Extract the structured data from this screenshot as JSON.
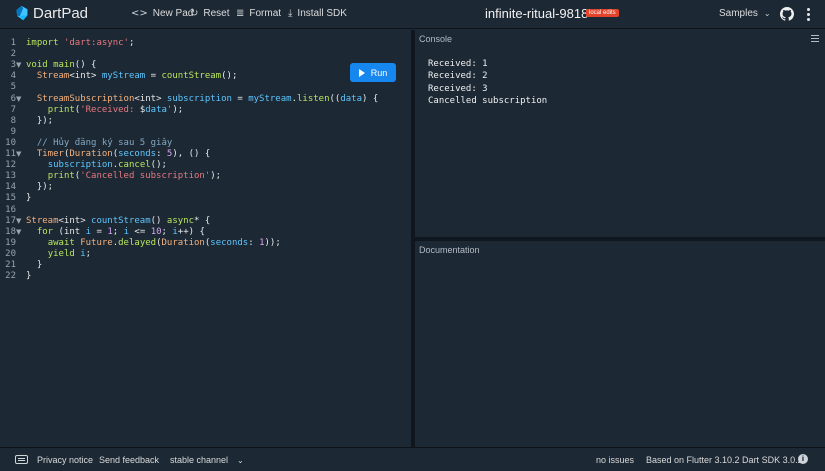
{
  "header": {
    "brand": "DartPad",
    "new_pad": "New Pad",
    "reset": "Reset",
    "format": "Format",
    "install_sdk": "Install SDK",
    "title": "infinite-ritual-9818",
    "badge": "local edits",
    "samples": "Samples"
  },
  "editor": {
    "run_label": "Run",
    "lines": [
      {
        "n": "1",
        "fold": "",
        "tokens": [
          [
            "kw",
            "import "
          ],
          [
            "str",
            "'dart:async'"
          ],
          [
            "pl",
            ";"
          ]
        ]
      },
      {
        "n": "2",
        "fold": "",
        "tokens": []
      },
      {
        "n": "3",
        "fold": "▼",
        "tokens": [
          [
            "kw",
            "void "
          ],
          [
            "fn",
            "main"
          ],
          [
            "pl",
            "() {"
          ]
        ]
      },
      {
        "n": "4",
        "fold": "",
        "tokens": [
          [
            "pl",
            "  "
          ],
          [
            "ty",
            "Stream"
          ],
          [
            "pl",
            "<int> "
          ],
          [
            "id",
            "myStream"
          ],
          [
            "pl",
            " = "
          ],
          [
            "fn",
            "countStream"
          ],
          [
            "pl",
            "();"
          ]
        ]
      },
      {
        "n": "5",
        "fold": "",
        "tokens": []
      },
      {
        "n": "6",
        "fold": "▼",
        "tokens": [
          [
            "pl",
            "  "
          ],
          [
            "ty",
            "StreamSubscription"
          ],
          [
            "pl",
            "<int> "
          ],
          [
            "id",
            "subscription"
          ],
          [
            "pl",
            " = "
          ],
          [
            "id",
            "myStream"
          ],
          [
            "pl",
            "."
          ],
          [
            "fn",
            "listen"
          ],
          [
            "pl",
            "(("
          ],
          [
            "id",
            "data"
          ],
          [
            "pl",
            ") {"
          ]
        ]
      },
      {
        "n": "7",
        "fold": "",
        "tokens": [
          [
            "pl",
            "    "
          ],
          [
            "fn",
            "print"
          ],
          [
            "pl",
            "("
          ],
          [
            "str",
            "'Received: "
          ],
          [
            "pl",
            "$"
          ],
          [
            "id",
            "data"
          ],
          [
            "str",
            "'"
          ],
          [
            "pl",
            ");"
          ]
        ]
      },
      {
        "n": "8",
        "fold": "",
        "tokens": [
          [
            "pl",
            "  });"
          ]
        ]
      },
      {
        "n": "9",
        "fold": "",
        "tokens": []
      },
      {
        "n": "10",
        "fold": "",
        "tokens": [
          [
            "cm",
            "  // Hủy đăng ký sau 5 giây"
          ]
        ]
      },
      {
        "n": "11",
        "fold": "▼",
        "tokens": [
          [
            "pl",
            "  "
          ],
          [
            "ty",
            "Timer"
          ],
          [
            "pl",
            "("
          ],
          [
            "ty",
            "Duration"
          ],
          [
            "pl",
            "("
          ],
          [
            "id",
            "seconds"
          ],
          [
            "pl",
            ": "
          ],
          [
            "num",
            "5"
          ],
          [
            "pl",
            "), () {"
          ]
        ]
      },
      {
        "n": "12",
        "fold": "",
        "tokens": [
          [
            "pl",
            "    "
          ],
          [
            "id",
            "subscription"
          ],
          [
            "pl",
            "."
          ],
          [
            "fn",
            "cancel"
          ],
          [
            "pl",
            "();"
          ]
        ]
      },
      {
        "n": "13",
        "fold": "",
        "tokens": [
          [
            "pl",
            "    "
          ],
          [
            "fn",
            "print"
          ],
          [
            "pl",
            "("
          ],
          [
            "str",
            "'Cancelled subscription'"
          ],
          [
            "pl",
            ");"
          ]
        ]
      },
      {
        "n": "14",
        "fold": "",
        "tokens": [
          [
            "pl",
            "  });"
          ]
        ]
      },
      {
        "n": "15",
        "fold": "",
        "tokens": [
          [
            "pl",
            "}"
          ]
        ]
      },
      {
        "n": "16",
        "fold": "",
        "tokens": []
      },
      {
        "n": "17",
        "fold": "▼",
        "tokens": [
          [
            "ty",
            "Stream"
          ],
          [
            "pl",
            "<int> "
          ],
          [
            "id",
            "countStream"
          ],
          [
            "pl",
            "() "
          ],
          [
            "kw",
            "async"
          ],
          [
            "pl",
            "* {"
          ]
        ]
      },
      {
        "n": "18",
        "fold": "▼",
        "tokens": [
          [
            "pl",
            "  "
          ],
          [
            "kw",
            "for "
          ],
          [
            "pl",
            "(int "
          ],
          [
            "id",
            "i"
          ],
          [
            "pl",
            " = "
          ],
          [
            "num",
            "1"
          ],
          [
            "pl",
            "; "
          ],
          [
            "id",
            "i"
          ],
          [
            "pl",
            " <= "
          ],
          [
            "num",
            "10"
          ],
          [
            "pl",
            "; "
          ],
          [
            "id",
            "i"
          ],
          [
            "pl",
            "++) {"
          ]
        ]
      },
      {
        "n": "19",
        "fold": "",
        "tokens": [
          [
            "pl",
            "    "
          ],
          [
            "kw",
            "await "
          ],
          [
            "ty",
            "Future"
          ],
          [
            "pl",
            "."
          ],
          [
            "fn",
            "delayed"
          ],
          [
            "pl",
            "("
          ],
          [
            "ty",
            "Duration"
          ],
          [
            "pl",
            "("
          ],
          [
            "id",
            "seconds"
          ],
          [
            "pl",
            ": "
          ],
          [
            "num",
            "1"
          ],
          [
            "pl",
            "));"
          ]
        ]
      },
      {
        "n": "20",
        "fold": "",
        "tokens": [
          [
            "pl",
            "    "
          ],
          [
            "kw",
            "yield "
          ],
          [
            "id",
            "i"
          ],
          [
            "pl",
            ";"
          ]
        ]
      },
      {
        "n": "21",
        "fold": "",
        "tokens": [
          [
            "pl",
            "  }"
          ]
        ]
      },
      {
        "n": "22",
        "fold": "",
        "tokens": [
          [
            "pl",
            "}"
          ]
        ]
      }
    ]
  },
  "console": {
    "title": "Console",
    "output": [
      "Received: 1",
      "Received: 2",
      "Received: 3",
      "Cancelled subscription"
    ]
  },
  "documentation": {
    "title": "Documentation"
  },
  "status": {
    "privacy": "Privacy notice",
    "feedback": "Send feedback",
    "channel": "stable channel",
    "issues": "no issues",
    "version": "Based on Flutter 3.10.2 Dart SDK 3.0.2"
  }
}
